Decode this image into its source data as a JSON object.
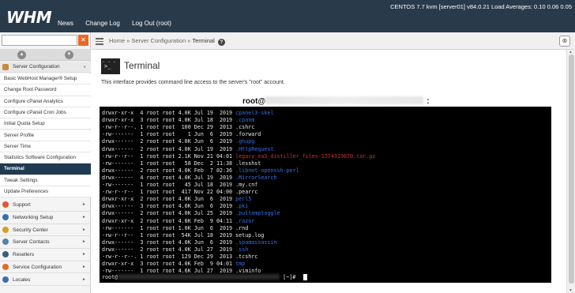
{
  "topbar": {
    "logo": "WHM",
    "nav": [
      "News",
      "Change Log",
      "Log Out (root)"
    ],
    "sysinfo": "CENTOS 7.7 kvm [server01]   v84.0.21   Load Averages: 0.10 0.06 0.05"
  },
  "sidebar": {
    "search_placeholder": "",
    "sections": [
      {
        "label": "Server Configuration",
        "icon_color": "#c9893a",
        "arrow": "∨",
        "expanded": true
      }
    ],
    "items": [
      "Basic WebHost Manager® Setup",
      "Change Root Password",
      "Configure cPanel Analytics",
      "Configure cPanel Cron Jobs",
      "Initial Quota Setup",
      "Server Profile",
      "Server Time",
      "Statistics Software Configuration",
      "Terminal",
      "Tweak Settings",
      "Update Preferences"
    ],
    "active_item": "Terminal",
    "collapsed_sections": [
      {
        "label": "Support",
        "icon_color": "#e0572e"
      },
      {
        "label": "Networking Setup",
        "icon_color": "#3a6fb0"
      },
      {
        "label": "Security Center",
        "icon_color": "#d4a11e"
      },
      {
        "label": "Server Contacts",
        "icon_color": "#5a7fa8"
      },
      {
        "label": "Resellers",
        "icon_color": "#3d5a80"
      },
      {
        "label": "Service Configuration",
        "icon_color": "#e46a2b"
      },
      {
        "label": "Locales",
        "icon_color": "#3d6fb0"
      }
    ]
  },
  "breadcrumb": {
    "home": "Home",
    "section": "Server Configuration",
    "current": "Terminal",
    "sep": "»"
  },
  "page": {
    "title": "Terminal",
    "description": "This interface provides command line access to the server's \"root\" account.",
    "user_label": "root@",
    "user_suffix": ":"
  },
  "terminal": {
    "lines": [
      {
        "perm": "drwxr-xr-x",
        "links": "4",
        "owner": "root",
        "group": "root",
        "size": "4.0K",
        "date": "Jul 19  2019",
        "name": "cpanel3-skel",
        "color": "blue"
      },
      {
        "perm": "drwxr-xr-x",
        "links": "3",
        "owner": "root",
        "group": "root",
        "size": "4.0K",
        "date": "Jul 18  2019",
        "name": ".cpanm",
        "color": "blue"
      },
      {
        "perm": "-rw-r--r--.",
        "links": "1",
        "owner": "root",
        "group": "root",
        "size": "100",
        "date": "Dec 29  2013",
        "name": ".cshrc",
        "color": "normal"
      },
      {
        "perm": "-rw-------",
        "links": "1",
        "owner": "root",
        "group": "root",
        "size": "1",
        "date": "Jun  6  2019",
        "name": ".forward",
        "color": "normal"
      },
      {
        "perm": "drwx------",
        "links": "2",
        "owner": "root",
        "group": "root",
        "size": "4.0K",
        "date": "Jun  6  2019",
        "name": ".gnupg",
        "color": "blue"
      },
      {
        "perm": "drwx------",
        "links": "2",
        "owner": "root",
        "group": "root",
        "size": "4.0K",
        "date": "Jul 19  2019",
        "name": ".HttpRequest",
        "color": "blue"
      },
      {
        "perm": "-rw-r--r--",
        "links": "1",
        "owner": "root",
        "group": "root",
        "size": "2.1K",
        "date": "Nov 21 04:01",
        "name": "legacy_ea3_distiller_files-1574319670.tar.gz",
        "color": "red"
      },
      {
        "perm": "-rw-------",
        "links": "1",
        "owner": "root",
        "group": "root",
        "size": "58",
        "date": "Dec  2 11:38",
        "name": ".lesshst",
        "color": "normal"
      },
      {
        "perm": "drwx------",
        "links": "2",
        "owner": "root",
        "group": "root",
        "size": "4.0K",
        "date": "Feb  7 02:36",
        "name": ".libnet-openssh-perl",
        "color": "blue"
      },
      {
        "perm": "drwx------",
        "links": "4",
        "owner": "root",
        "group": "root",
        "size": "4.0K",
        "date": "Jul 19  2019",
        "name": ".MirrorSearch",
        "color": "blue"
      },
      {
        "perm": "-rw-------",
        "links": "1",
        "owner": "root",
        "group": "root",
        "size": "45",
        "date": "Jul 18  2019",
        "name": ".my.cnf",
        "color": "normal"
      },
      {
        "perm": "-rw-r--r--",
        "links": "1",
        "owner": "root",
        "group": "root",
        "size": "417",
        "date": "Nov 22 04:00",
        "name": ".pearrc",
        "color": "normal"
      },
      {
        "perm": "drwxr-xr-x",
        "links": "2",
        "owner": "root",
        "group": "root",
        "size": "4.0K",
        "date": "Jun  6  2019",
        "name": "perl5",
        "color": "blue"
      },
      {
        "perm": "drwx------",
        "links": "3",
        "owner": "root",
        "group": "root",
        "size": "4.0K",
        "date": "Jun  6  2019",
        "name": ".pki",
        "color": "blue"
      },
      {
        "perm": "drwx------",
        "links": "2",
        "owner": "root",
        "group": "root",
        "size": "4.0K",
        "date": "Jul 25  2019",
        "name": ".puttemptoggle",
        "color": "blue"
      },
      {
        "perm": "drwxr-xr-x",
        "links": "2",
        "owner": "root",
        "group": "root",
        "size": "4.0K",
        "date": "Feb  9 04:11",
        "name": ".razor",
        "color": "blue"
      },
      {
        "perm": "-rw-------",
        "links": "1",
        "owner": "root",
        "group": "root",
        "size": "1.0K",
        "date": "Jun  6  2019",
        "name": ".rnd",
        "color": "normal"
      },
      {
        "perm": "-rw-r--r--",
        "links": "1",
        "owner": "root",
        "group": "root",
        "size": "54K",
        "date": "Jul 18  2019",
        "name": "setup.log",
        "color": "normal"
      },
      {
        "perm": "drwx------",
        "links": "3",
        "owner": "root",
        "group": "root",
        "size": "4.0K",
        "date": "Jun  6  2019",
        "name": ".spamassassin",
        "color": "blue"
      },
      {
        "perm": "drwx------",
        "links": "2",
        "owner": "root",
        "group": "root",
        "size": "4.0K",
        "date": "Jul 27  2019",
        "name": ".ssh",
        "color": "blue"
      },
      {
        "perm": "-rw-r--r--.",
        "links": "1",
        "owner": "root",
        "group": "root",
        "size": "129",
        "date": "Dec 29  2013",
        "name": ".tcshrc",
        "color": "normal"
      },
      {
        "perm": "drwxr-xr-x",
        "links": "3",
        "owner": "root",
        "group": "root",
        "size": "4.0K",
        "date": "Feb  9 04:01",
        "name": "tmp",
        "color": "blue"
      },
      {
        "perm": "-rw-------",
        "links": "1",
        "owner": "root",
        "group": "root",
        "size": "4.6K",
        "date": "Jul 27  2019",
        "name": ".viminfo",
        "color": "normal"
      }
    ],
    "prompt_user": "root@",
    "prompt_tail": "[~]#"
  }
}
